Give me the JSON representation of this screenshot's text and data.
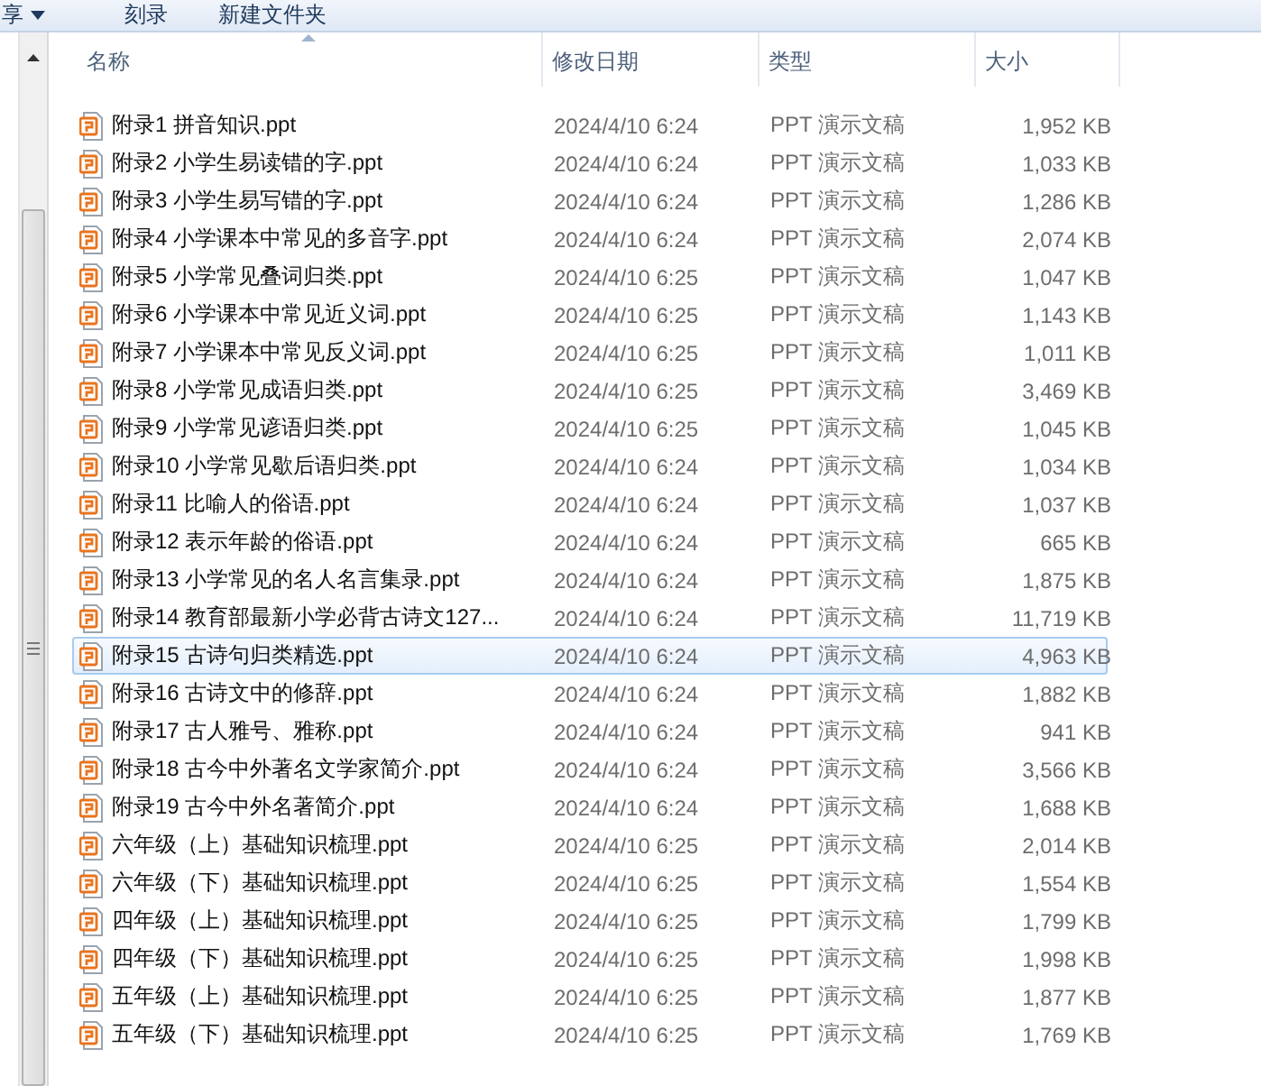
{
  "toolbar": {
    "items": [
      {
        "label": "享",
        "has_menu": true
      },
      {
        "label": "刻录",
        "has_menu": false
      },
      {
        "label": "新建文件夹",
        "has_menu": false
      }
    ]
  },
  "columns": [
    "名称",
    "修改日期",
    "类型",
    "大小"
  ],
  "files": [
    {
      "name": "附录1 拼音知识.ppt",
      "date": "2024/4/10 6:24",
      "type": "PPT 演示文稿",
      "size": "1,952 KB",
      "selected": false
    },
    {
      "name": "附录2 小学生易读错的字.ppt",
      "date": "2024/4/10 6:24",
      "type": "PPT 演示文稿",
      "size": "1,033 KB",
      "selected": false
    },
    {
      "name": "附录3 小学生易写错的字.ppt",
      "date": "2024/4/10 6:24",
      "type": "PPT 演示文稿",
      "size": "1,286 KB",
      "selected": false
    },
    {
      "name": "附录4 小学课本中常见的多音字.ppt",
      "date": "2024/4/10 6:24",
      "type": "PPT 演示文稿",
      "size": "2,074 KB",
      "selected": false
    },
    {
      "name": "附录5 小学常见叠词归类.ppt",
      "date": "2024/4/10 6:25",
      "type": "PPT 演示文稿",
      "size": "1,047 KB",
      "selected": false
    },
    {
      "name": "附录6 小学课本中常见近义词.ppt",
      "date": "2024/4/10 6:25",
      "type": "PPT 演示文稿",
      "size": "1,143 KB",
      "selected": false
    },
    {
      "name": "附录7 小学课本中常见反义词.ppt",
      "date": "2024/4/10 6:25",
      "type": "PPT 演示文稿",
      "size": "1,011 KB",
      "selected": false
    },
    {
      "name": "附录8 小学常见成语归类.ppt",
      "date": "2024/4/10 6:25",
      "type": "PPT 演示文稿",
      "size": "3,469 KB",
      "selected": false
    },
    {
      "name": "附录9 小学常见谚语归类.ppt",
      "date": "2024/4/10 6:25",
      "type": "PPT 演示文稿",
      "size": "1,045 KB",
      "selected": false
    },
    {
      "name": "附录10 小学常见歇后语归类.ppt",
      "date": "2024/4/10 6:24",
      "type": "PPT 演示文稿",
      "size": "1,034 KB",
      "selected": false
    },
    {
      "name": "附录11 比喻人的俗语.ppt",
      "date": "2024/4/10 6:24",
      "type": "PPT 演示文稿",
      "size": "1,037 KB",
      "selected": false
    },
    {
      "name": "附录12 表示年龄的俗语.ppt",
      "date": "2024/4/10 6:24",
      "type": "PPT 演示文稿",
      "size": "665 KB",
      "selected": false
    },
    {
      "name": "附录13 小学常见的名人名言集录.ppt",
      "date": "2024/4/10 6:24",
      "type": "PPT 演示文稿",
      "size": "1,875 KB",
      "selected": false
    },
    {
      "name": "附录14 教育部最新小学必背古诗文127...",
      "date": "2024/4/10 6:24",
      "type": "PPT 演示文稿",
      "size": "11,719 KB",
      "selected": false
    },
    {
      "name": "附录15 古诗句归类精选.ppt",
      "date": "2024/4/10 6:24",
      "type": "PPT 演示文稿",
      "size": "4,963 KB",
      "selected": true
    },
    {
      "name": "附录16 古诗文中的修辞.ppt",
      "date": "2024/4/10 6:24",
      "type": "PPT 演示文稿",
      "size": "1,882 KB",
      "selected": false
    },
    {
      "name": "附录17 古人雅号、雅称.ppt",
      "date": "2024/4/10 6:24",
      "type": "PPT 演示文稿",
      "size": "941 KB",
      "selected": false
    },
    {
      "name": "附录18 古今中外著名文学家简介.ppt",
      "date": "2024/4/10 6:24",
      "type": "PPT 演示文稿",
      "size": "3,566 KB",
      "selected": false
    },
    {
      "name": "附录19 古今中外名著简介.ppt",
      "date": "2024/4/10 6:24",
      "type": "PPT 演示文稿",
      "size": "1,688 KB",
      "selected": false
    },
    {
      "name": "六年级（上）基础知识梳理.ppt",
      "date": "2024/4/10 6:25",
      "type": "PPT 演示文稿",
      "size": "2,014 KB",
      "selected": false
    },
    {
      "name": "六年级（下）基础知识梳理.ppt",
      "date": "2024/4/10 6:25",
      "type": "PPT 演示文稿",
      "size": "1,554 KB",
      "selected": false
    },
    {
      "name": "四年级（上）基础知识梳理.ppt",
      "date": "2024/4/10 6:25",
      "type": "PPT 演示文稿",
      "size": "1,799 KB",
      "selected": false
    },
    {
      "name": "四年级（下）基础知识梳理.ppt",
      "date": "2024/4/10 6:25",
      "type": "PPT 演示文稿",
      "size": "1,998 KB",
      "selected": false
    },
    {
      "name": "五年级（上）基础知识梳理.ppt",
      "date": "2024/4/10 6:25",
      "type": "PPT 演示文稿",
      "size": "1,877 KB",
      "selected": false
    },
    {
      "name": "五年级（下）基础知识梳理.ppt",
      "date": "2024/4/10 6:25",
      "type": "PPT 演示文稿",
      "size": "1,769 KB",
      "selected": false
    }
  ]
}
